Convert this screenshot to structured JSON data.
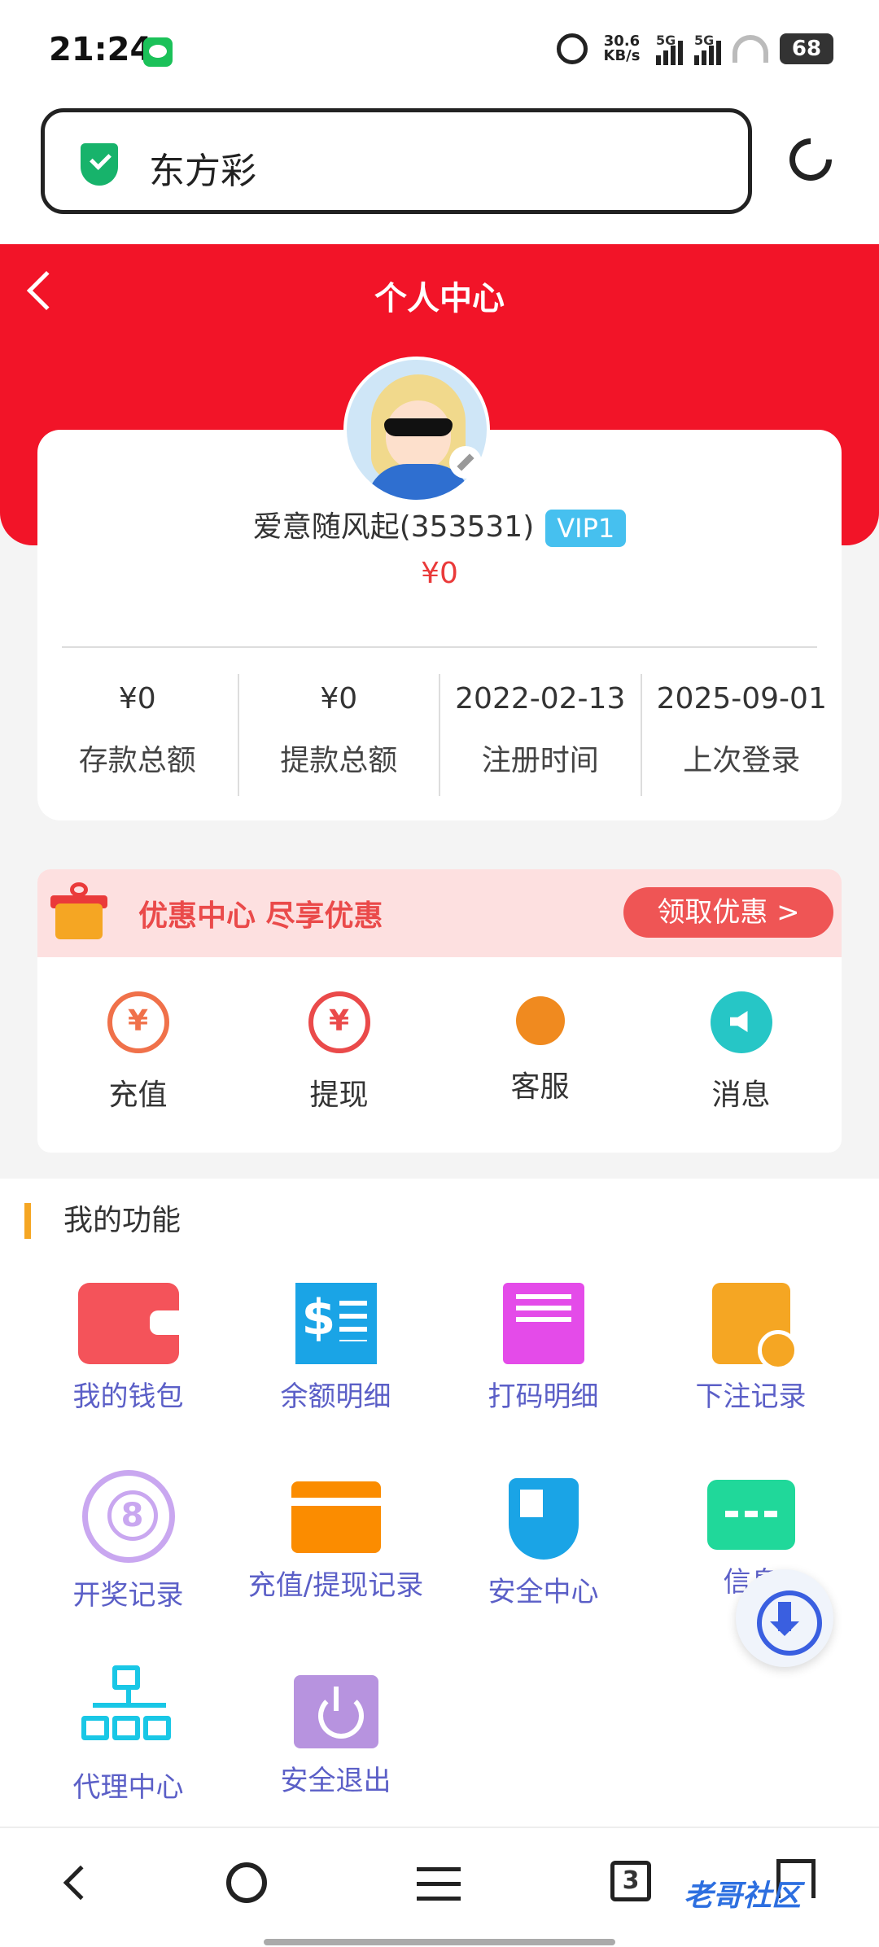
{
  "status_bar": {
    "time": "21:24",
    "speed": "30.6\nKB/s",
    "sig1": "5G",
    "sig2": "5G",
    "battery": "68"
  },
  "browser": {
    "address": "东方彩"
  },
  "header": {
    "title": "个人中心"
  },
  "profile": {
    "username": "爱意随风起(353531)",
    "vip": "VIP1",
    "balance": "¥0",
    "stats": [
      {
        "value": "¥0",
        "label": "存款总额"
      },
      {
        "value": "¥0",
        "label": "提款总额"
      },
      {
        "value": "2022-02-13",
        "label": "注册时间"
      },
      {
        "value": "2025-09-01",
        "label": "上次登录"
      }
    ]
  },
  "promo": {
    "text": "优惠中心 尽享优惠",
    "button": "领取优惠 >"
  },
  "quick_actions": [
    {
      "label": "充值",
      "icon": "recharge-icon"
    },
    {
      "label": "提现",
      "icon": "withdraw-icon"
    },
    {
      "label": "客服",
      "icon": "customer-service-icon"
    },
    {
      "label": "消息",
      "icon": "message-icon"
    }
  ],
  "functions": {
    "title": "我的功能",
    "items": [
      {
        "label": "我的钱包",
        "icon": "wallet-icon"
      },
      {
        "label": "余额明细",
        "icon": "receipt-icon"
      },
      {
        "label": "打码明细",
        "icon": "print-icon"
      },
      {
        "label": "下注记录",
        "icon": "bet-record-icon"
      },
      {
        "label": "开奖记录",
        "icon": "lottery-ball-icon"
      },
      {
        "label": "充值/提现记录",
        "icon": "card-icon"
      },
      {
        "label": "安全中心",
        "icon": "shield-icon"
      },
      {
        "label": "信息",
        "icon": "chat-icon"
      },
      {
        "label": "代理中心",
        "icon": "org-chart-icon"
      },
      {
        "label": "安全退出",
        "icon": "power-icon"
      }
    ]
  },
  "bottom_nav": {
    "tabs_count": "3",
    "watermark": "老哥社区"
  },
  "colors": {
    "primary_red": "#f21428",
    "vip_blue": "#46c0ef",
    "label_purple": "#5b5fc7"
  }
}
